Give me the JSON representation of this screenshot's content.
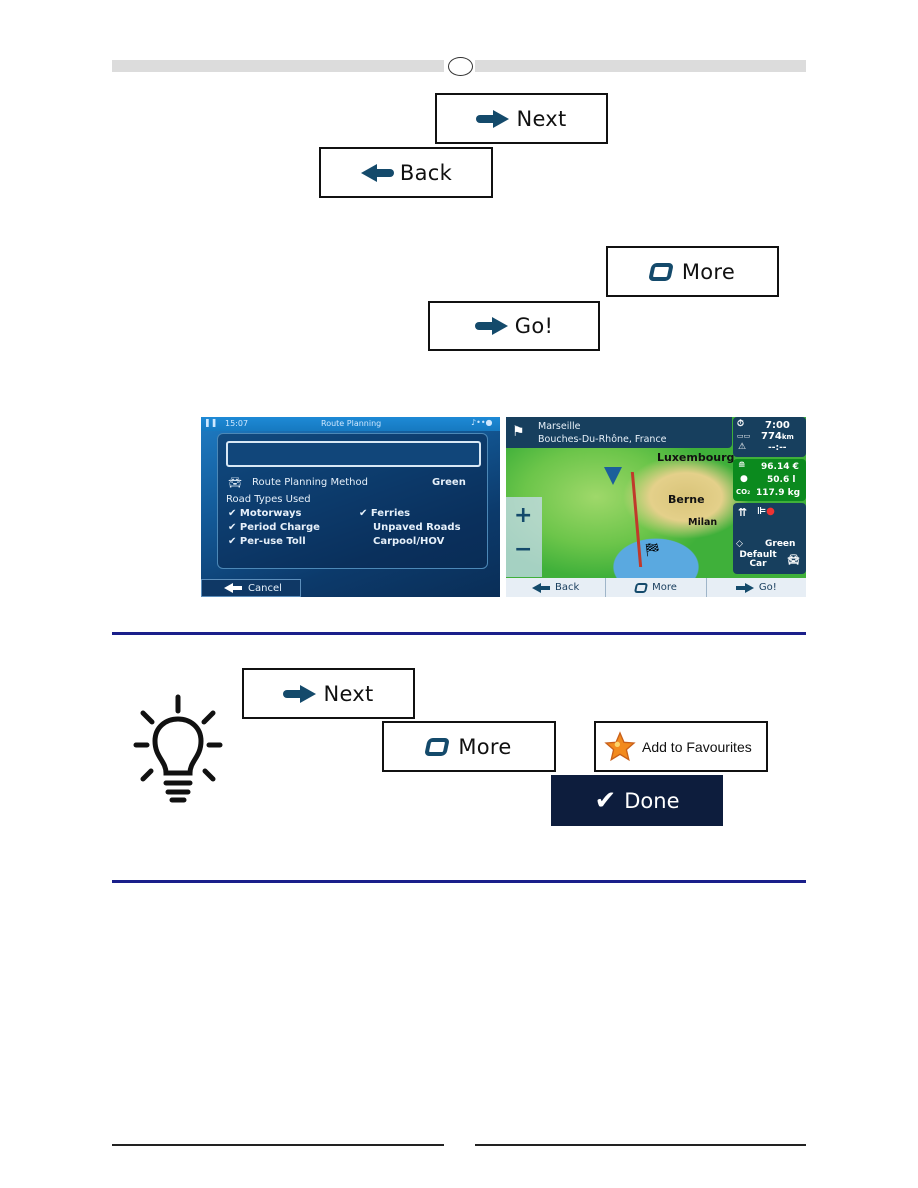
{
  "header": {
    "circle_marker": ""
  },
  "top_buttons": {
    "next": {
      "label": "Next",
      "icon": "arrow-right-icon"
    },
    "back": {
      "label": "Back",
      "icon": "arrow-left-icon"
    },
    "more": {
      "label": "More",
      "icon": "more-icon"
    },
    "go": {
      "label": "Go!",
      "icon": "arrow-right-icon"
    }
  },
  "route_planning_screen": {
    "time": "15:07",
    "title": "Route Planning",
    "route_input_value": "",
    "method_label": "Route Planning Method",
    "method_value": "Green",
    "road_types_heading": "Road Types Used",
    "road_types": [
      {
        "label": "Motorways",
        "checked": true
      },
      {
        "label": "Period Charge",
        "checked": true
      },
      {
        "label": "Per-use Toll",
        "checked": true
      },
      {
        "label": "Ferries",
        "checked": true
      },
      {
        "label": "Unpaved Roads",
        "checked": false
      },
      {
        "label": "Carpool/HOV",
        "checked": false
      }
    ],
    "check_glyph": "✔",
    "cancel_label": "Cancel"
  },
  "route_summary_screen": {
    "destination_name": "Marseille",
    "destination_region": "Bouches-Du-Rhône, France",
    "cities": [
      "Luxembourg",
      "Berne",
      "Milan"
    ],
    "zoom_in": "+",
    "zoom_out": "−",
    "stats": {
      "time": "7:00",
      "distance": "774",
      "distance_unit": "km",
      "eta": "--:--",
      "cost": "96.14 €",
      "fuel": "50.6 l",
      "co2_label": "CO₂",
      "co2": "117.9 kg",
      "route_method": "Green",
      "vehicle": "Default Car"
    },
    "bottom_buttons": {
      "back": "Back",
      "more": "More",
      "go": "Go!"
    }
  },
  "tip_section": {
    "next_label": "Next",
    "more_label": "More",
    "add_fav_label": "Add to Favourites",
    "done_label": "Done",
    "done_glyph": "✔"
  },
  "colors": {
    "icon_blue": "#144a6b",
    "separator_blue": "#1a1f8a",
    "done_bg": "#0d1d3d",
    "eco_green": "#0b8a1e",
    "panel_dark": "#173f5e"
  }
}
